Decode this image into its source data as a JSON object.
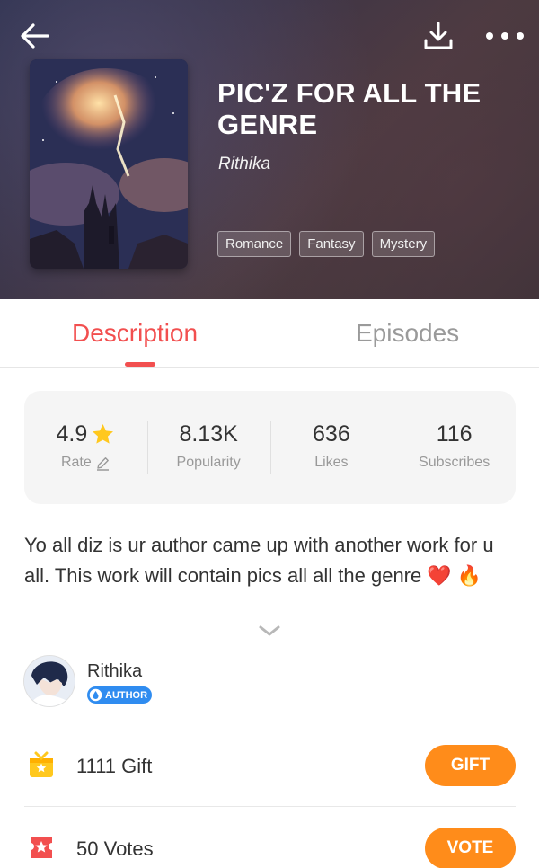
{
  "header": {
    "book_title": "PIC'Z FOR ALL THE GENRE",
    "author": "Rithika",
    "tags": [
      "Romance",
      "Fantasy",
      "Mystery"
    ]
  },
  "tabs": [
    {
      "label": "Description",
      "active": true
    },
    {
      "label": "Episodes",
      "active": false
    }
  ],
  "stats": {
    "rating": {
      "value": "4.9",
      "label": "Rate"
    },
    "popularity": {
      "value": "8.13K",
      "label": "Popularity"
    },
    "likes": {
      "value": "636",
      "label": "Likes"
    },
    "subscribes": {
      "value": "116",
      "label": "Subscribes"
    }
  },
  "description": "Yo all diz is ur author came up with another work for u all. This work will contain pics all all the genre ❤️ 🔥",
  "author_section": {
    "name": "Rithika",
    "badge": "AUTHOR"
  },
  "gift": {
    "count": "1111",
    "label": "Gift",
    "button": "GIFT"
  },
  "vote": {
    "count": "50",
    "label": "Votes",
    "button": "VOTE"
  },
  "colors": {
    "accent": "#f24f4f",
    "action": "#ff8c1a",
    "badge": "#2f8cf0",
    "star": "#ffc81e"
  },
  "icons": [
    "back-arrow-icon",
    "download-icon",
    "more-icon",
    "star-icon",
    "pencil-icon",
    "chevron-down-icon",
    "gift-icon",
    "vote-ticket-icon",
    "author-drop-icon"
  ]
}
